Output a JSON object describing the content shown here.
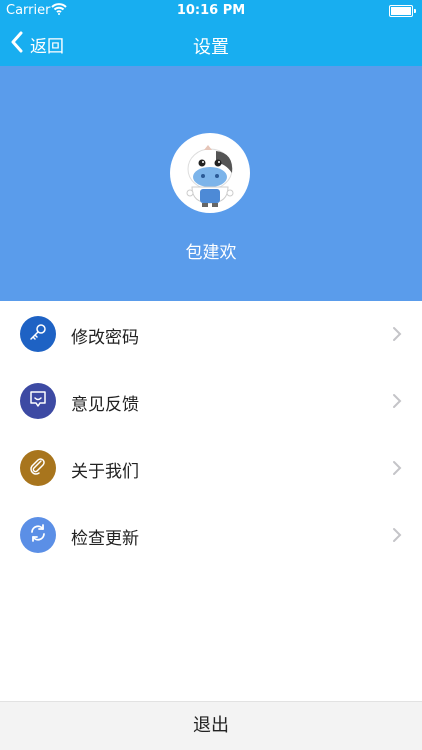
{
  "status_bar": {
    "carrier": "Carrier",
    "time": "10:16 PM"
  },
  "nav": {
    "back_label": "返回",
    "title": "设置"
  },
  "profile": {
    "name": "包建欢"
  },
  "menu": [
    {
      "label": "修改密码",
      "icon": "key-icon",
      "color": "#1e62c4"
    },
    {
      "label": "意见反馈",
      "icon": "feedback-chat-icon",
      "color": "#3d4aa3"
    },
    {
      "label": "关于我们",
      "icon": "paperclip-icon",
      "color": "#a8751d"
    },
    {
      "label": "检查更新",
      "icon": "refresh-icon",
      "color": "#5b8fe6"
    }
  ],
  "logout_label": "退出"
}
